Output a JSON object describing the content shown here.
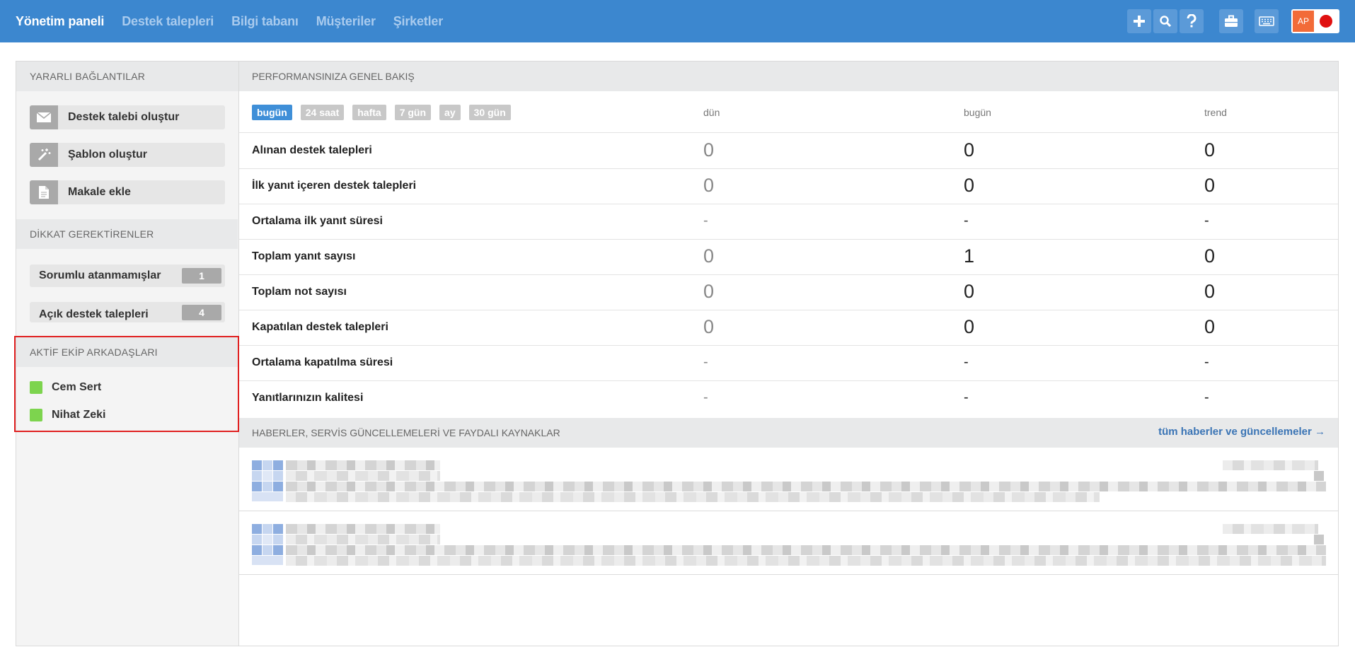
{
  "nav": {
    "items": [
      {
        "label": "Yönetim paneli",
        "active": true
      },
      {
        "label": "Destek talepleri",
        "active": false
      },
      {
        "label": "Bilgi tabanı",
        "active": false
      },
      {
        "label": "Müşteriler",
        "active": false
      },
      {
        "label": "Şirketler",
        "active": false
      }
    ],
    "tools": [
      "plus-icon",
      "search-icon",
      "help-icon",
      "briefcase-icon",
      "keyboard-icon"
    ],
    "profile_initials": "AP",
    "colors": {
      "topbar": "#3c87cf",
      "status_dot": "#e01010",
      "avatar": "#f26b38"
    }
  },
  "sidebar": {
    "useful_links": {
      "title": "YARARLI BAĞLANTILAR",
      "items": [
        {
          "label": "Destek talebi oluştur",
          "icon": "envelope-icon"
        },
        {
          "label": "Şablon oluştur",
          "icon": "magic-wand-icon"
        },
        {
          "label": "Makale ekle",
          "icon": "document-icon"
        }
      ]
    },
    "attention": {
      "title": "DİKKAT GEREKTİRENLER",
      "items": [
        {
          "label": "Sorumlu atanmamışlar",
          "count": "1"
        },
        {
          "label": "Açık destek talepleri",
          "count": "4"
        }
      ]
    },
    "team": {
      "title": "AKTİF EKİP ARKADAŞLARI",
      "members": [
        {
          "name": "Cem Sert",
          "status_color": "#7dd44e"
        },
        {
          "name": "Nihat Zeki",
          "status_color": "#7dd44e"
        }
      ]
    }
  },
  "performance": {
    "title": "PERFORMANSINIZA GENEL BAKIŞ",
    "tabs": [
      {
        "label": "bugün",
        "active": true
      },
      {
        "label": "24 saat",
        "active": false
      },
      {
        "label": "hafta",
        "active": false
      },
      {
        "label": "7 gün",
        "active": false
      },
      {
        "label": "ay",
        "active": false
      },
      {
        "label": "30 gün",
        "active": false
      }
    ],
    "columns": {
      "yesterday": "dün",
      "today": "bugün",
      "trend": "trend"
    },
    "rows": [
      {
        "label": "Alınan destek talepleri",
        "yesterday": "0",
        "today": "0",
        "trend": "0"
      },
      {
        "label": "İlk yanıt içeren destek talepleri",
        "yesterday": "0",
        "today": "0",
        "trend": "0"
      },
      {
        "label": "Ortalama ilk yanıt süresi",
        "yesterday": "-",
        "today": "-",
        "trend": "-"
      },
      {
        "label": "Toplam yanıt sayısı",
        "yesterday": "0",
        "today": "1",
        "trend": "0"
      },
      {
        "label": "Toplam not sayısı",
        "yesterday": "0",
        "today": "0",
        "trend": "0"
      },
      {
        "label": "Kapatılan destek talepleri",
        "yesterday": "0",
        "today": "0",
        "trend": "0"
      },
      {
        "label": "Ortalama kapatılma süresi",
        "yesterday": "-",
        "today": "-",
        "trend": "-"
      },
      {
        "label": "Yanıtlarınızın kalitesi",
        "yesterday": "-",
        "today": "-",
        "trend": "-"
      }
    ]
  },
  "news": {
    "title": "HABERLER, SERVİS GÜNCELLEMELERİ VE FAYDALI KAYNAKLAR",
    "all_link": "tüm haberler ve güncellemeler →"
  }
}
